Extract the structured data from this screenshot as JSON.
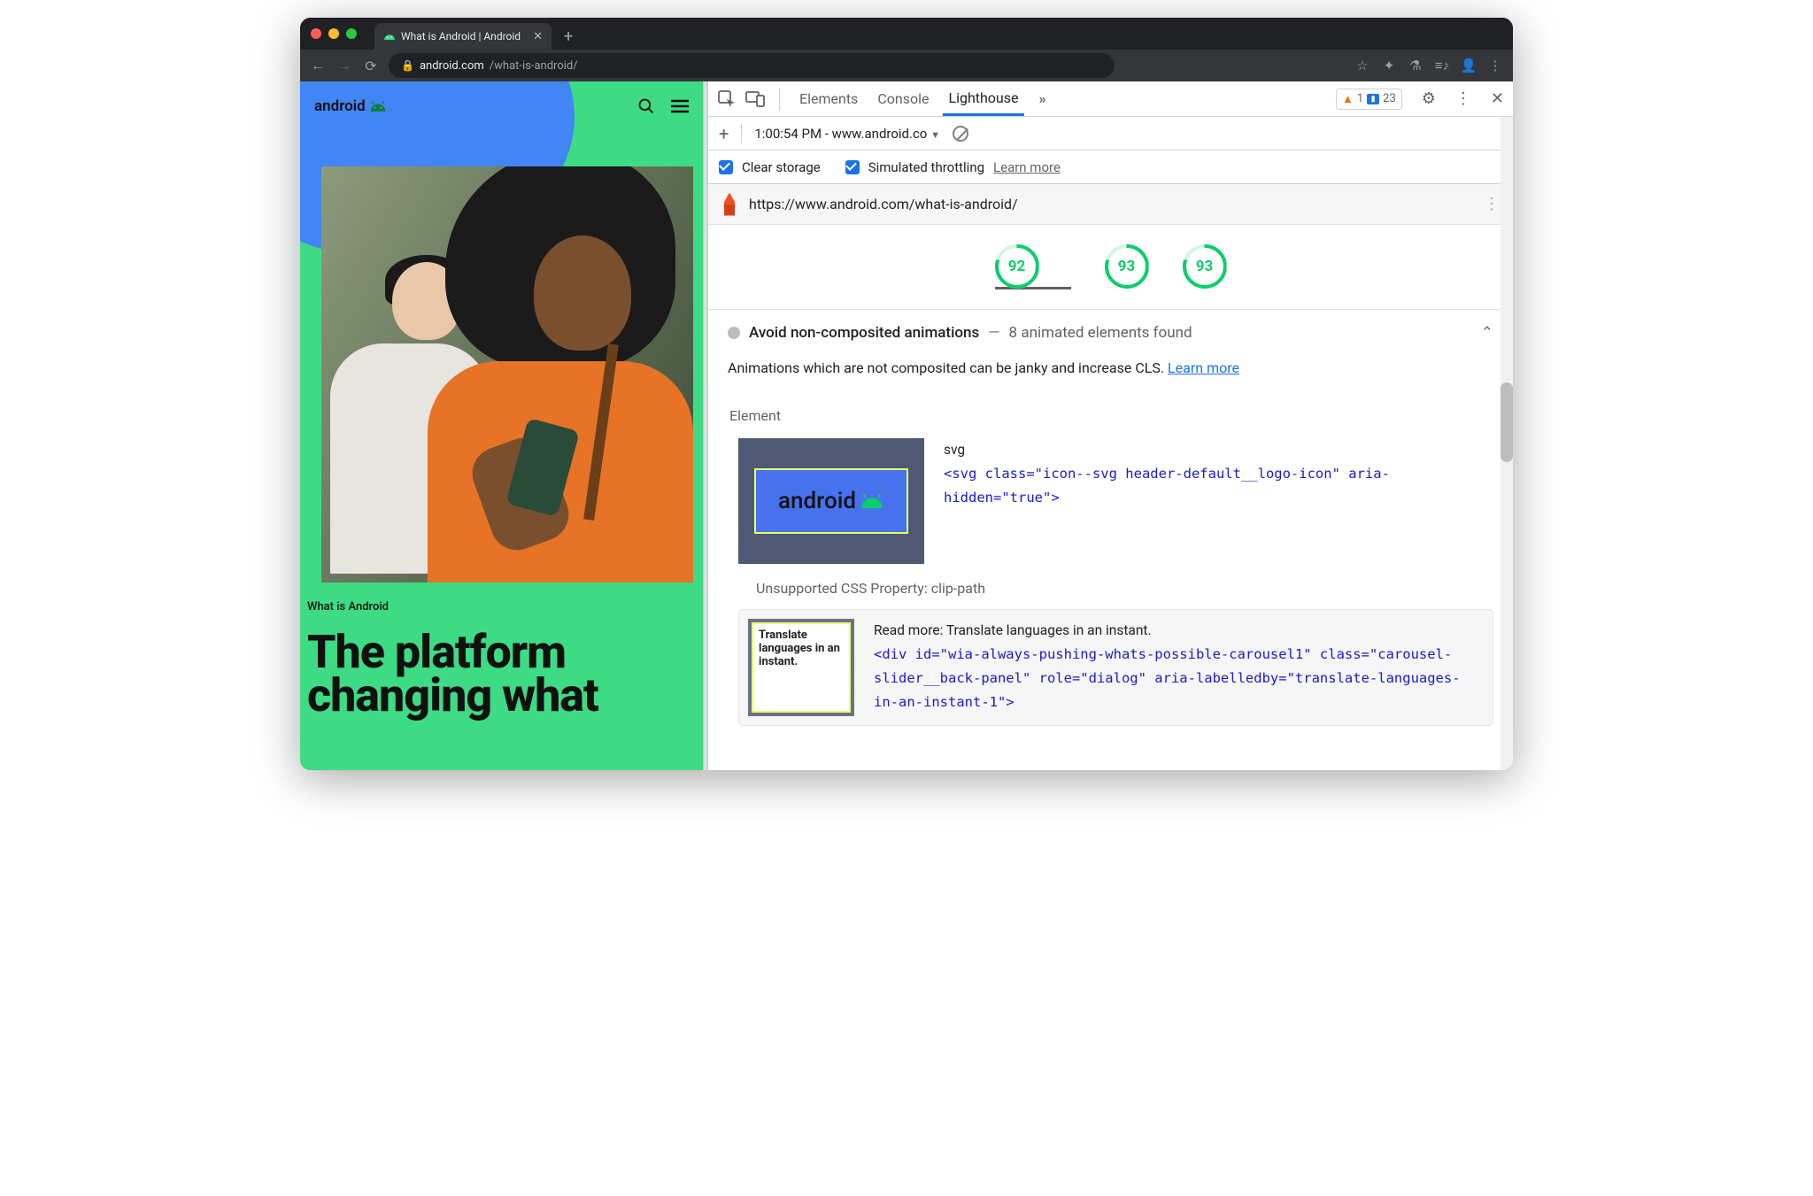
{
  "browser": {
    "tab_title": "What is Android | Android",
    "url_host": "android.com",
    "url_path": "/what-is-android/"
  },
  "page": {
    "brand": "android",
    "kicker": "What is Android",
    "headline_line1": "The platform",
    "headline_line2": "changing what"
  },
  "devtools": {
    "tabs": {
      "elements": "Elements",
      "console": "Console",
      "lighthouse": "Lighthouse"
    },
    "warn_count": "1",
    "info_count": "23",
    "report_label": "1:00:54 PM - www.android.co",
    "clear_storage": "Clear storage",
    "sim_throttle": "Simulated throttling",
    "learn_more": "Learn more",
    "audited_url": "https://www.android.com/what-is-android/",
    "scores": {
      "a": "92",
      "b": "93",
      "c": "93"
    },
    "audit_title": "Avoid non-composited animations",
    "audit_sub": "8 animated elements found",
    "audit_desc": "Animations which are not composited can be janky and increase CLS. ",
    "audit_learn": "Learn more",
    "element_label": "Element",
    "el1_tag": "svg",
    "el1_code": "<svg class=\"icon--svg header-default__logo-icon\" aria-hidden=\"true\">",
    "thumb1_text": "android",
    "subissue": "Unsupported CSS Property: clip-path",
    "el2_readmore": "Read more: Translate languages in an instant.",
    "el2_code": "<div id=\"wia-always-pushing-whats-possible-carousel1\" class=\"carousel-slider__back-panel\" role=\"dialog\" aria-labelledby=\"translate-languages-in-an-instant-1\">",
    "thumb2_l1": "Translate",
    "thumb2_l2": "languages in an",
    "thumb2_l3": "instant."
  }
}
